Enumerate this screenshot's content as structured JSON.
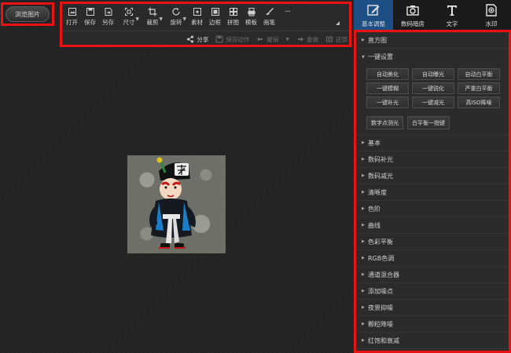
{
  "browse_button": "浏览图片",
  "toolbar": {
    "tools": [
      {
        "label": "打开",
        "icon": "open-icon"
      },
      {
        "label": "保存",
        "icon": "save-icon"
      },
      {
        "label": "另存",
        "icon": "save-as-icon"
      },
      {
        "label": "尺寸",
        "icon": "resize-icon"
      },
      {
        "label": "裁剪",
        "icon": "crop-icon"
      },
      {
        "label": "旋转",
        "icon": "rotate-icon"
      },
      {
        "label": "素材",
        "icon": "material-icon"
      },
      {
        "label": "边框",
        "icon": "border-icon"
      },
      {
        "label": "拼图",
        "icon": "collage-icon"
      },
      {
        "label": "模板",
        "icon": "template-icon"
      },
      {
        "label": "画笔",
        "icon": "brush-icon"
      }
    ],
    "more": "···",
    "actions": {
      "share": "分享",
      "save_action": "保存动作",
      "undo": "撤销",
      "redo": "重做",
      "restore": "还原"
    }
  },
  "top_tabs": [
    {
      "label": "基本调整",
      "icon": "edit-adjust-icon",
      "active": true
    },
    {
      "label": "数码暗房",
      "icon": "camera-icon",
      "active": false
    },
    {
      "label": "文字",
      "icon": "text-icon",
      "active": false
    },
    {
      "label": "水印",
      "icon": "watermark-icon",
      "active": false
    }
  ],
  "panel": {
    "histogram": "直方图",
    "one_click": "一键设置",
    "quick_buttons": [
      "自动美化",
      "自动曝光",
      "自动白平衡",
      "一键模糊",
      "一键锐化",
      "严重白平衡",
      "一键补光",
      "一键减光",
      "高ISO降噪"
    ],
    "quick_buttons_row2": [
      "数字点测光",
      "白平衡一指键"
    ],
    "sections": [
      "基本",
      "数码补光",
      "数码减光",
      "清晰度",
      "色阶",
      "曲线",
      "色彩平衡",
      "RGB色调",
      "通道混合器",
      "添加噪点",
      "夜景抑噪",
      "颗粒降噪",
      "红饱和衰减"
    ]
  }
}
